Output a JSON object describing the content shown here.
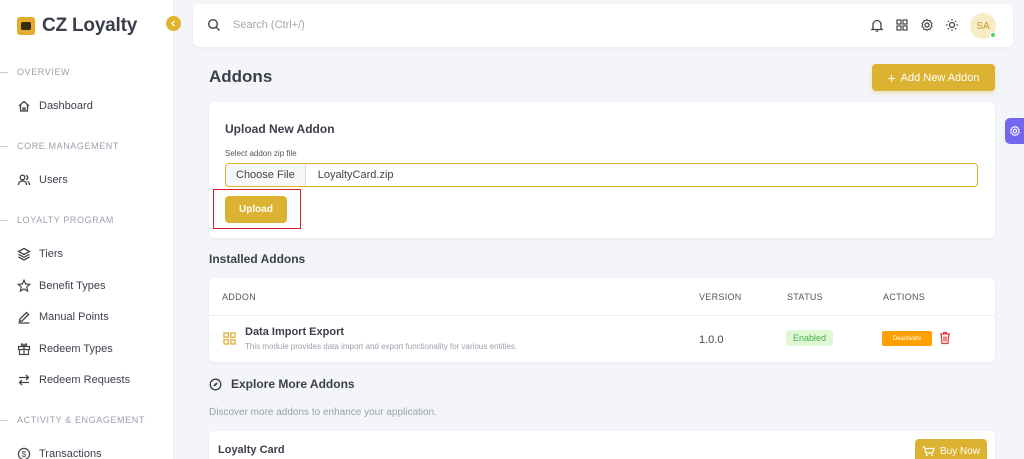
{
  "brand": {
    "name": "CZ Loyalty"
  },
  "sidebar": {
    "sections": [
      {
        "label": "OVERVIEW"
      },
      {
        "label": "CORE MANAGEMENT"
      },
      {
        "label": "LOYALTY PROGRAM"
      },
      {
        "label": "ACTIVITY & ENGAGEMENT"
      }
    ],
    "items": [
      {
        "label": "Dashboard",
        "icon": "home-icon"
      },
      {
        "label": "Users",
        "icon": "users-icon"
      },
      {
        "label": "Tiers",
        "icon": "layers-icon"
      },
      {
        "label": "Benefit Types",
        "icon": "star-icon"
      },
      {
        "label": "Manual Points",
        "icon": "pencil-icon"
      },
      {
        "label": "Redeem Types",
        "icon": "gift-icon"
      },
      {
        "label": "Redeem Requests",
        "icon": "swap-icon"
      },
      {
        "label": "Transactions",
        "icon": "dollar-icon"
      }
    ]
  },
  "topbar": {
    "search_placeholder": "Search (Ctrl+/)",
    "avatar_initials": "SA"
  },
  "page": {
    "title": "Addons",
    "add_button": "Add New Addon"
  },
  "upload": {
    "title": "Upload New Addon",
    "field_label": "Select addon zip file",
    "choose_file": "Choose File",
    "file_name": "LoyaltyCard.zip",
    "upload_button": "Upload"
  },
  "installed": {
    "title": "Installed Addons",
    "columns": [
      "ADDON",
      "VERSION",
      "STATUS",
      "ACTIONS"
    ],
    "rows": [
      {
        "name": "Data Import Export",
        "description": "This module provides data import and export functionality for various entities.",
        "version": "1.0.0",
        "status": "Enabled",
        "action": "Deactivate"
      }
    ]
  },
  "explore": {
    "title": "Explore More Addons",
    "subtitle": "Discover more addons to enhance your application.",
    "items": [
      {
        "name": "Loyalty Card",
        "button": "Buy Now"
      }
    ]
  },
  "colors": {
    "accent": "#dcb232",
    "badge_enabled": "#4caf50",
    "deactivate": "#ffa000",
    "danger": "#e53935",
    "customizer": "#7367f0"
  }
}
